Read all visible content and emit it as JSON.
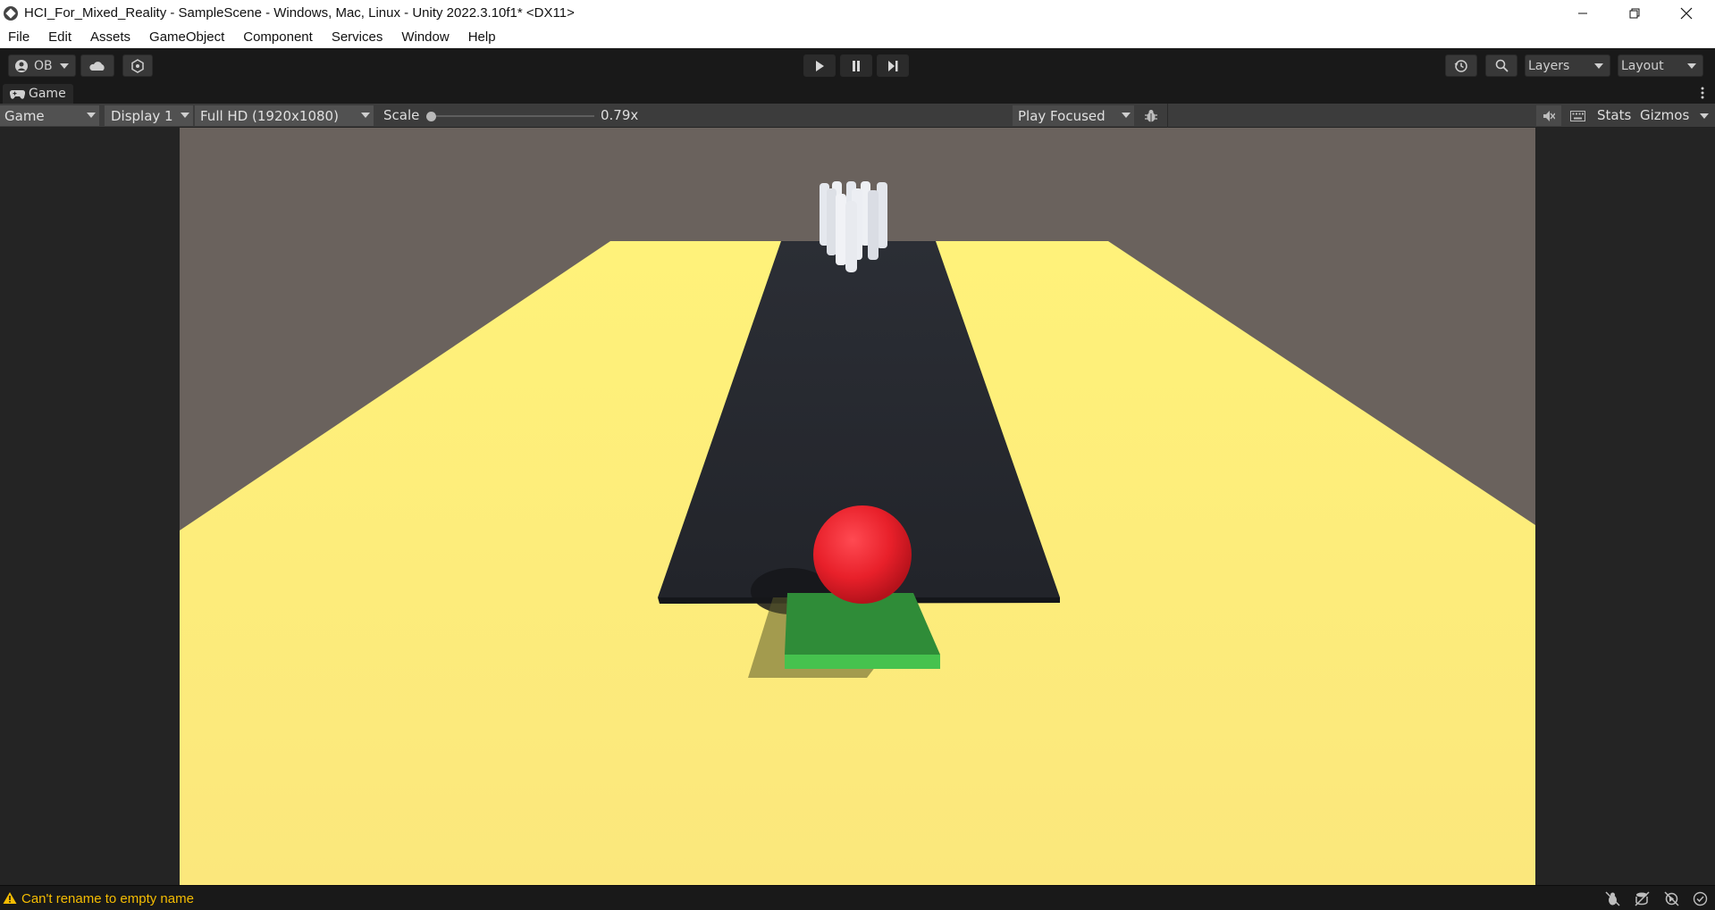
{
  "window": {
    "title": "HCI_For_Mixed_Reality - SampleScene - Windows, Mac, Linux - Unity 2022.3.10f1* <DX11>",
    "controls": [
      "minimize-icon",
      "restore-icon",
      "close-icon"
    ]
  },
  "menubar": {
    "items": [
      "File",
      "Edit",
      "Assets",
      "GameObject",
      "Component",
      "Services",
      "Window",
      "Help"
    ]
  },
  "toolbar": {
    "account_label": "OB",
    "play_icon": "play-icon",
    "pause_icon": "pause-icon",
    "step_icon": "step-icon",
    "layers_label": "Layers",
    "layout_label": "Layout"
  },
  "game_panel": {
    "tab_label": "Game",
    "view_mode": "Game",
    "display": "Display 1",
    "resolution": "Full HD (1920x1080)",
    "scale_label": "Scale",
    "scale_value": "0.79x",
    "scale_fraction": 0.0,
    "play_mode": "Play Focused",
    "stats_label": "Stats",
    "gizmos_label": "Gizmos"
  },
  "scene_colors": {
    "background": "#6a625d",
    "floor": "#fff27a",
    "lane": "#23252b",
    "ball": "#e8202a",
    "pad": "#3fbd47",
    "pins": "#eef0f4"
  },
  "statusbar": {
    "message": "Can't rename to empty name",
    "warning_color": "#f4bc02"
  }
}
